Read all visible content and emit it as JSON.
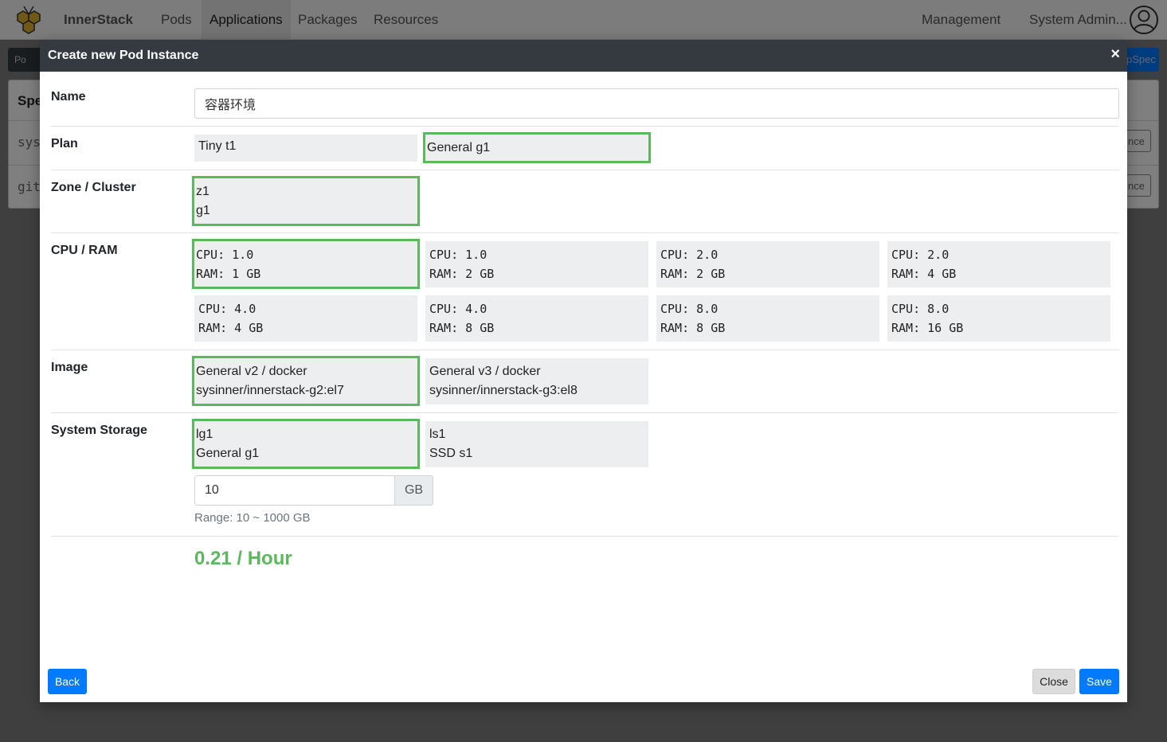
{
  "app": {
    "brand": "InnerStack",
    "nav": [
      "Pods",
      "Applications",
      "Packages",
      "Resources"
    ],
    "active_nav": "Applications",
    "right_nav": [
      "Management",
      "System Admin..."
    ]
  },
  "background": {
    "subbar_left": "Po",
    "subbar_right": "pSpec",
    "panel_header": "Spe",
    "rows": [
      "sys",
      "git"
    ],
    "row_button": "nce"
  },
  "modal": {
    "title": "Create new Pod Instance",
    "close_symbol": "×",
    "name": {
      "label": "Name",
      "value": "容器环境"
    },
    "plan": {
      "label": "Plan",
      "options": [
        "Tiny t1",
        "General g1"
      ],
      "selected": 1
    },
    "zone": {
      "label": "Zone / Cluster",
      "options": [
        {
          "line1": "z1",
          "line2": "g1"
        }
      ],
      "selected": 0
    },
    "cpu_ram": {
      "label": "CPU / RAM",
      "options": [
        {
          "cpu": "CPU: 1.0",
          "ram": "RAM: 1 GB"
        },
        {
          "cpu": "CPU: 1.0",
          "ram": "RAM: 2 GB"
        },
        {
          "cpu": "CPU: 2.0",
          "ram": "RAM: 2 GB"
        },
        {
          "cpu": "CPU: 2.0",
          "ram": "RAM: 4 GB"
        },
        {
          "cpu": "CPU: 4.0",
          "ram": "RAM: 4 GB"
        },
        {
          "cpu": "CPU: 4.0",
          "ram": "RAM: 8 GB"
        },
        {
          "cpu": "CPU: 8.0",
          "ram": "RAM: 8 GB"
        },
        {
          "cpu": "CPU: 8.0",
          "ram": "RAM: 16 GB"
        }
      ],
      "selected": 0
    },
    "image": {
      "label": "Image",
      "options": [
        {
          "line1": "General v2 / docker",
          "line2": "sysinner/innerstack-g2:el7"
        },
        {
          "line1": "General v3 / docker",
          "line2": "sysinner/innerstack-g3:el8"
        }
      ],
      "selected": 0
    },
    "storage": {
      "label": "System Storage",
      "options": [
        {
          "line1": "lg1",
          "line2": "General g1"
        },
        {
          "line1": "ls1",
          "line2": "SSD s1"
        }
      ],
      "selected": 0,
      "size_value": "10",
      "size_unit": "GB",
      "range_hint": "Range: 10 ~ 1000 GB"
    },
    "price": "0.21 / Hour",
    "buttons": {
      "back": "Back",
      "close": "Close",
      "save": "Save"
    }
  },
  "colors": {
    "selected_border": "#5cb85c",
    "primary": "#007bff",
    "header_bg": "#343a40",
    "price": "#5cb85c"
  }
}
